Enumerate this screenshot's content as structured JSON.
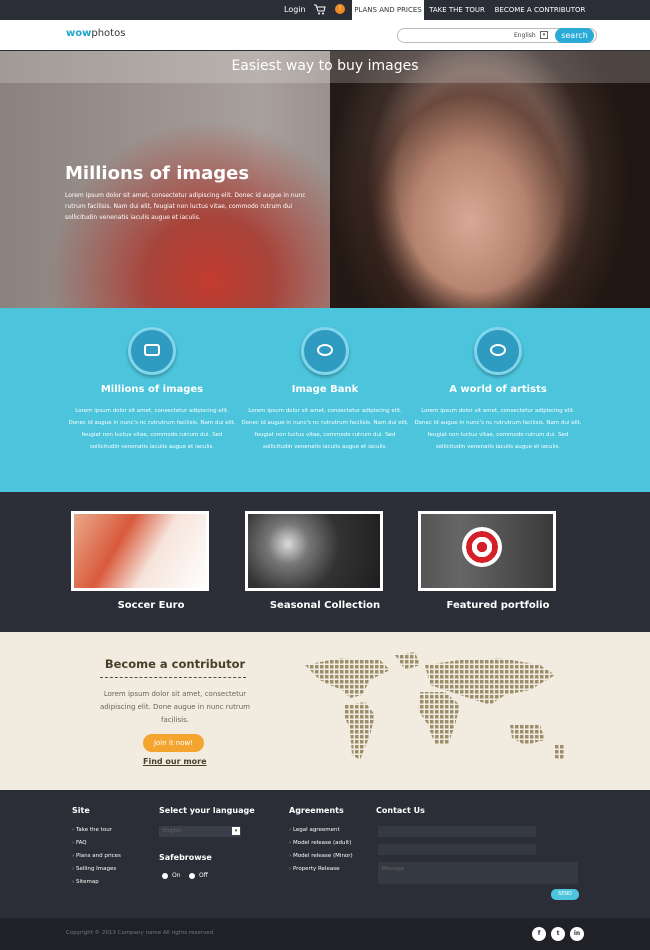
{
  "topbar": {
    "login": "Login",
    "cart_count": "!",
    "tabs": [
      "PLANS AND PRICES",
      "TAKE THE TOUR",
      "BECOME A CONTRIBUTOR"
    ]
  },
  "header": {
    "logo_bold": "wow",
    "logo_rest": "photos",
    "language": "English",
    "search_label": "search"
  },
  "hero": {
    "tagline": "Easiest way to buy images",
    "title": "Millions of images",
    "description": "Lorem ipsum dolor sit amet, consectetur adipiscing elit. Donec id augue in nunc rutrum facilisis. Nam dui elit, feugiat non luctus vitae, commodo rutrum dui sollicitudin venenatis iaculis augue et iaculis."
  },
  "features": [
    {
      "title": "Millions of images",
      "description": "Lorem ipsum dolor sit amet, consectetur adipiscing elit. Donec id augue in nunc's nc rutrutrum facilisis. Nam dui elit, feugiat non luctus vitae, commodo rutrum dui. Sed sollicitudin venenatis iaculis augue et iaculis."
    },
    {
      "title": "Image Bank",
      "description": "Lorem ipsum dolor sit amet, consectetur adipiscing elit. Donec id augue in nunc's nc rutrutrum facilisis. Nam dui elit, feugiat non luctus vitae, commodo rutrum dui. Sed sollicitudin venenatis iaculis augue et iaculis."
    },
    {
      "title": "A world of artists",
      "description": "Lorem ipsum dolor sit amet, consectetur adipiscing elit. Donec id augue in nunc's nc rutrutrum facilisis. Nam dui elit, feugiat non luctus vitae, commodo rutrum dui. Sed sollicitudin venenatis iaculis augue et iaculis."
    }
  ],
  "portfolio": [
    "Soccer Euro",
    "Seasonal Collection",
    "Featured portfolio"
  ],
  "contributor": {
    "title": "Become a contributor",
    "description": "Lorem ipsum dolor sit amet, consectetur adipiscing elit. Done augue in nunc rutrum facilisis.",
    "join_label": "Join it now!",
    "find_more": "Find our more"
  },
  "footer": {
    "site_title": "Site",
    "site_links": [
      "Take the tour",
      "FAQ",
      "Plans and prices",
      "Selling Images",
      "Sitemap"
    ],
    "lang_title": "Select your language",
    "lang_value": "English",
    "safebrowse_title": "Safebrowse",
    "on_label": "On",
    "off_label": "Off",
    "agreements_title": "Agreements",
    "agreement_links": [
      "Legal agreement",
      "Model release (adult)",
      "Model release (Minor)",
      "Property Release"
    ],
    "contact_title": "Contact Us",
    "message_placeholder": "Message",
    "send_label": "SEND"
  },
  "bottom": {
    "copyright": "Copyright © 2013 Company name All rights reserved."
  },
  "social": [
    "f",
    "t",
    "in"
  ],
  "colors": {
    "accent": "#4cc4dc",
    "dark": "#2b2e36",
    "button_orange": "#f3a530",
    "search_blue": "#2aaad6"
  }
}
